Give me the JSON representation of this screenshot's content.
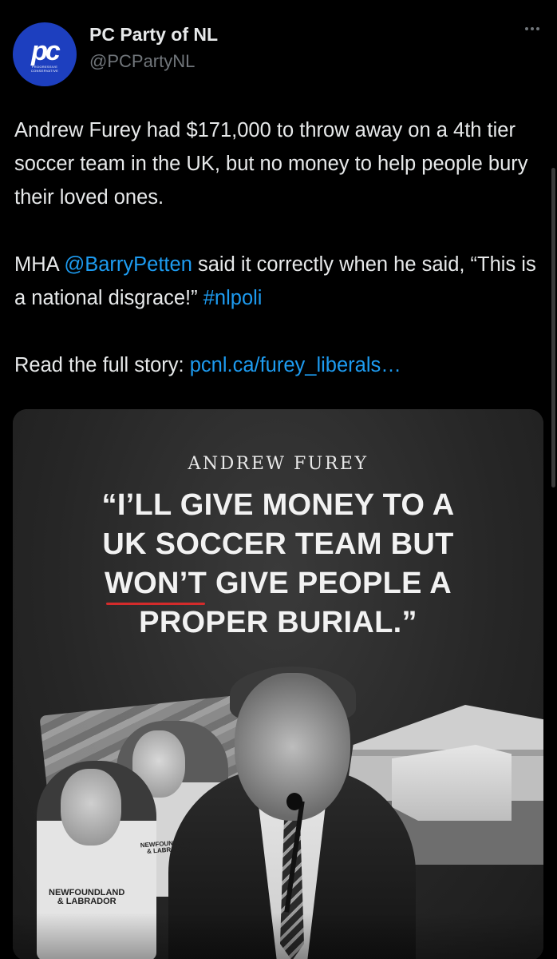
{
  "tweet": {
    "author": {
      "name": "PC Party of NL",
      "handle": "@PCPartyNL",
      "avatar_mark": "pc",
      "avatar_sub": "PROGRESSIVE\nCONSERVATIVE",
      "avatar_color": "#1d3fbf"
    },
    "more_icon": "more-horizontal-icon",
    "body": {
      "p1": "Andrew Furey had $171,000 to throw away on a 4th tier soccer team in the UK, but no money to help people bury their loved ones.",
      "p2_before": "MHA ",
      "p2_mention": "@BarryPetten",
      "p2_after": " said it correctly when he said, “This is a national disgrace!” ",
      "p2_hashtag": "#nlpoli",
      "p3_before": "Read the full story: ",
      "p3_link": "pcnl.ca/furey_liberals…"
    },
    "media": {
      "kicker": "ANDREW FUREY",
      "quote_line1": "“I’LL GIVE MONEY TO A",
      "quote_line2": "UK  SOCCER TEAM BUT",
      "quote_line3_underlined": "WON’T",
      "quote_line3_rest": " GIVE PEOPLE A",
      "quote_line4": "PROPER BURIAL.”",
      "jersey_text_1": "NEWFOUNDLAND\n& LABRADOR",
      "jersey_text_2": "NEWFOUNDLAND\n& LABRADOR",
      "underline_color": "#d42b2b"
    },
    "colors": {
      "background": "#000000",
      "text": "#e7e9ea",
      "secondary": "#71767b",
      "link": "#1d9bf0"
    }
  }
}
